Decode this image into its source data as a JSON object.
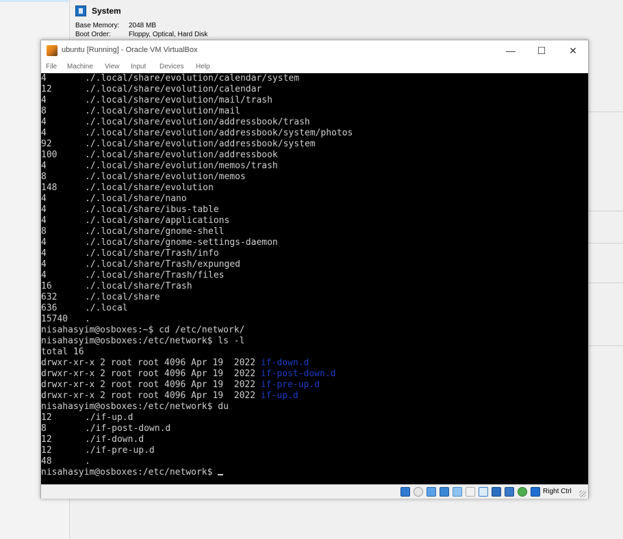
{
  "background": {
    "system_title": "System",
    "rows": [
      {
        "label": "Base Memory:",
        "value": "2048 MB"
      },
      {
        "label": "Boot Order:",
        "value": "Floppy, Optical, Hard Disk"
      }
    ]
  },
  "window": {
    "title": "ubuntu [Running] - Oracle VM VirtualBox",
    "minimize_glyph": "—",
    "maximize_glyph": "☐",
    "close_glyph": "✕"
  },
  "menu": [
    "File",
    "Machine",
    "View",
    "Input",
    "Devices",
    "Help"
  ],
  "terminal": {
    "du_lines": [
      {
        "size": "4",
        "path": "./.local/share/evolution/calendar/system"
      },
      {
        "size": "12",
        "path": "./.local/share/evolution/calendar"
      },
      {
        "size": "4",
        "path": "./.local/share/evolution/mail/trash"
      },
      {
        "size": "8",
        "path": "./.local/share/evolution/mail"
      },
      {
        "size": "4",
        "path": "./.local/share/evolution/addressbook/trash"
      },
      {
        "size": "4",
        "path": "./.local/share/evolution/addressbook/system/photos"
      },
      {
        "size": "92",
        "path": "./.local/share/evolution/addressbook/system"
      },
      {
        "size": "100",
        "path": "./.local/share/evolution/addressbook"
      },
      {
        "size": "4",
        "path": "./.local/share/evolution/memos/trash"
      },
      {
        "size": "8",
        "path": "./.local/share/evolution/memos"
      },
      {
        "size": "148",
        "path": "./.local/share/evolution"
      },
      {
        "size": "4",
        "path": "./.local/share/nano"
      },
      {
        "size": "4",
        "path": "./.local/share/ibus-table"
      },
      {
        "size": "4",
        "path": "./.local/share/applications"
      },
      {
        "size": "8",
        "path": "./.local/share/gnome-shell"
      },
      {
        "size": "4",
        "path": "./.local/share/gnome-settings-daemon"
      },
      {
        "size": "4",
        "path": "./.local/share/Trash/info"
      },
      {
        "size": "4",
        "path": "./.local/share/Trash/expunged"
      },
      {
        "size": "4",
        "path": "./.local/share/Trash/files"
      },
      {
        "size": "16",
        "path": "./.local/share/Trash"
      },
      {
        "size": "632",
        "path": "./.local/share"
      },
      {
        "size": "636",
        "path": "./.local"
      },
      {
        "size": "15740",
        "path": "."
      }
    ],
    "cmd1": "nisahasyim@osboxes:~$ cd /etc/network/",
    "cmd2": "nisahasyim@osboxes:/etc/network$ ls -l",
    "total": "total 16",
    "ls_lines": [
      {
        "meta": "drwxr-xr-x 2 root root 4096 Apr 19  2022 ",
        "name": "if-down.d"
      },
      {
        "meta": "drwxr-xr-x 2 root root 4096 Apr 19  2022 ",
        "name": "if-post-down.d"
      },
      {
        "meta": "drwxr-xr-x 2 root root 4096 Apr 19  2022 ",
        "name": "if-pre-up.d"
      },
      {
        "meta": "drwxr-xr-x 2 root root 4096 Apr 19  2022 ",
        "name": "if-up.d"
      }
    ],
    "cmd3": "nisahasyim@osboxes:/etc/network$ du",
    "du2_lines": [
      {
        "size": "12",
        "path": "./if-up.d"
      },
      {
        "size": "8",
        "path": "./if-post-down.d"
      },
      {
        "size": "12",
        "path": "./if-down.d"
      },
      {
        "size": "12",
        "path": "./if-pre-up.d"
      },
      {
        "size": "48",
        "path": "."
      }
    ],
    "prompt": "nisahasyim@osboxes:/etc/network$ "
  },
  "statusbar": {
    "icons": [
      "hard-disk-icon",
      "optical-disk-icon",
      "audio-icon",
      "network-icon",
      "usb-icon",
      "shared-folders-icon",
      "display-icon",
      "video-capture-icon",
      "cpu-icon",
      "mouse-integration-icon",
      "keyboard-icon"
    ],
    "host_key": "Right Ctrl"
  },
  "colors": {
    "terminal_bg": "#000000",
    "terminal_fg": "#d0d0d0",
    "dir_fg": "#1c3cc8"
  }
}
